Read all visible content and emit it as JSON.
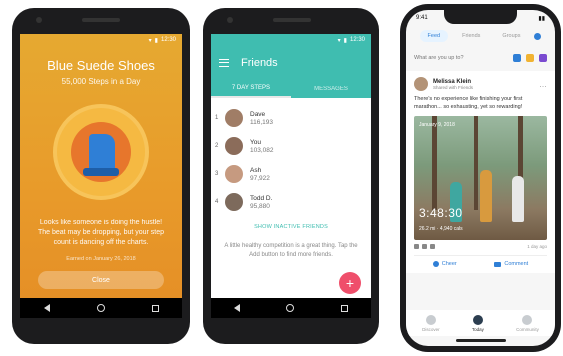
{
  "badge_screen": {
    "status_time": "12:30",
    "title": "Blue Suede Shoes",
    "subtitle": "55,000 Steps in a Day",
    "message": "Looks like someone is doing the hustle! The beat may be dropping, but your step count is dancing off the charts.",
    "earned_on": "Earned on January 26, 2018",
    "close_label": "Close",
    "colors": {
      "background": "#e89a2a",
      "shoe": "#2f7fd6"
    }
  },
  "friends_screen": {
    "status_time": "12:30",
    "title": "Friends",
    "tabs": [
      {
        "label": "7 DAY STEPS",
        "active": true
      },
      {
        "label": "MESSAGES",
        "active": false
      }
    ],
    "friends": [
      {
        "rank": "1",
        "name": "Dave",
        "steps": "116,193"
      },
      {
        "rank": "2",
        "name": "You",
        "steps": "103,082"
      },
      {
        "rank": "3",
        "name": "Ash",
        "steps": "97,922"
      },
      {
        "rank": "4",
        "name": "Todd D.",
        "steps": "95,880"
      }
    ],
    "show_inactive": "SHOW INACTIVE FRIENDS",
    "competition_text": "A little healthy competition is a great thing. Tap the Add button to find more friends.",
    "fab_label": "+",
    "colors": {
      "accent": "#3fbdb0",
      "fab": "#ef4f6b"
    }
  },
  "feed_screen": {
    "status_time": "9:41",
    "tabs": [
      {
        "label": "Feed",
        "active": true
      },
      {
        "label": "Friends",
        "active": false
      },
      {
        "label": "Groups",
        "active": false
      }
    ],
    "say_placeholder": "What are you up to?",
    "post": {
      "author": "Melissa Klein",
      "meta": "Shared with Friends",
      "text": "There's no experience like finishing your first marathon... so exhausting, yet so rewarding!",
      "photo_date": "January 9, 2018",
      "photo_time": "3:48:30",
      "photo_stats": "26.2 mi  ·  4,940 cals",
      "time_ago": "1 day ago"
    },
    "actions": {
      "cheer": "Cheer",
      "comment": "Comment"
    },
    "bottom_nav": [
      {
        "label": "Discover",
        "active": false
      },
      {
        "label": "Today",
        "active": true
      },
      {
        "label": "Community",
        "active": false
      }
    ],
    "colors": {
      "accent": "#2f7fd6"
    }
  }
}
